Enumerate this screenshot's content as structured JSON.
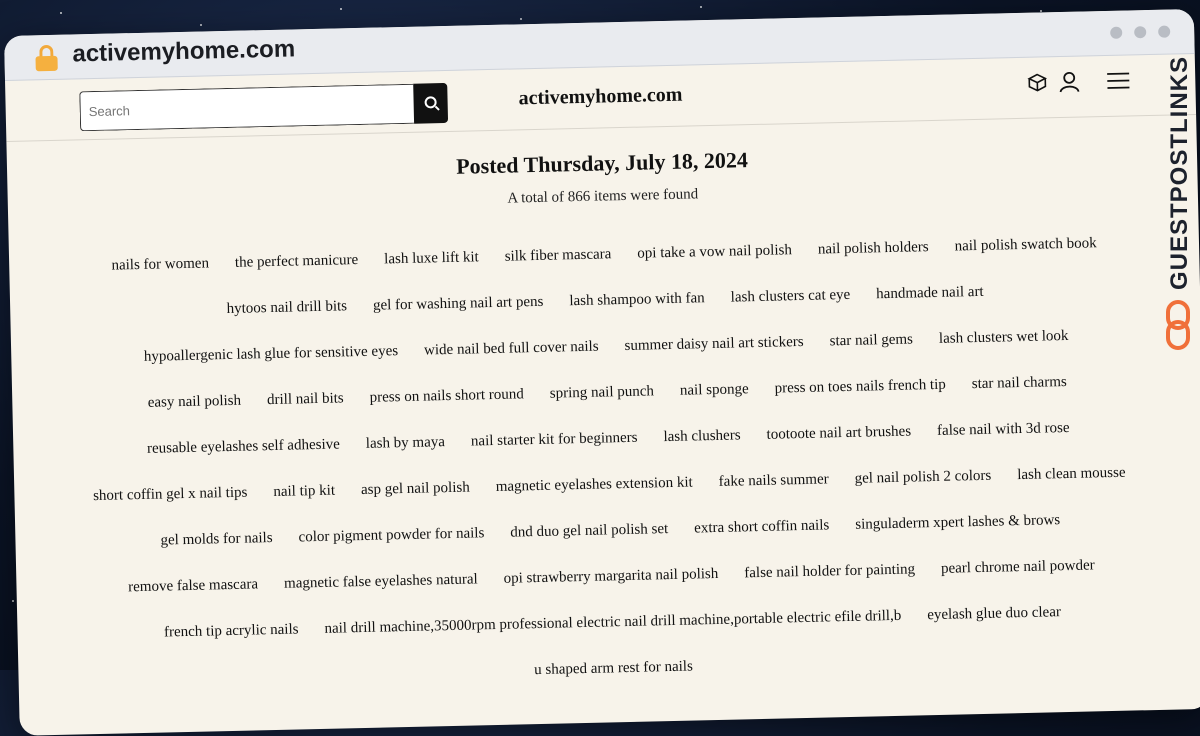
{
  "browser": {
    "url": "activemyhome.com"
  },
  "header": {
    "search_placeholder": "Search",
    "site_title": "activemyhome.com"
  },
  "main": {
    "posted": "Posted Thursday, July 18, 2024",
    "total": "A total of 866 items were found"
  },
  "tags": [
    "nails for women",
    "the perfect manicure",
    "lash luxe lift kit",
    "silk fiber mascara",
    "opi take a vow nail polish",
    "nail polish holders",
    "nail polish swatch book",
    "hytoos nail drill bits",
    "gel for washing nail art pens",
    "lash shampoo with fan",
    "lash clusters cat eye",
    "handmade nail art",
    "hypoallergenic lash glue for sensitive eyes",
    "wide nail bed full cover nails",
    "summer daisy nail art stickers",
    "star nail gems",
    "lash clusters wet look",
    "easy nail polish",
    "drill nail bits",
    "press on nails short round",
    "spring nail punch",
    "nail sponge",
    "press on toes nails french tip",
    "star nail charms",
    "reusable eyelashes self adhesive",
    "lash by maya",
    "nail starter kit for beginners",
    "lash clushers",
    "tootoote nail art brushes",
    "false nail with 3d rose",
    "short coffin gel x nail tips",
    "nail tip kit",
    "asp gel nail polish",
    "magnetic eyelashes extension kit",
    "fake nails summer",
    "gel nail polish 2 colors",
    "lash clean mousse",
    "gel molds for nails",
    "color pigment powder for nails",
    "dnd duo gel nail polish set",
    "extra short coffin nails",
    "singuladerm xpert lashes & brows",
    "remove false mascara",
    "magnetic false eyelashes natural",
    "opi strawberry margarita nail polish",
    "false nail holder for painting",
    "pearl chrome nail powder",
    "french tip acrylic nails",
    "nail drill machine,35000rpm professional electric nail drill machine,portable electric efile drill,b",
    "eyelash glue duo clear",
    "u shaped arm rest for nails"
  ],
  "banner": {
    "text": "GUESTPOSTLINKS"
  },
  "colors": {
    "background": "#f7f3ea",
    "banner_accent": "#f0703a",
    "lock": "#f5b03f"
  }
}
